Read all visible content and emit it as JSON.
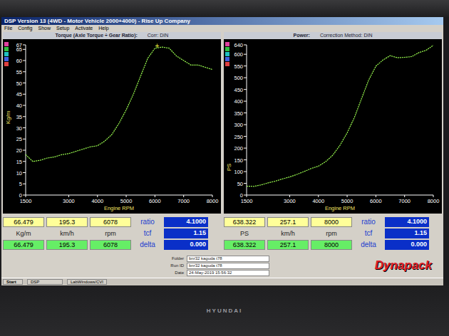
{
  "window": {
    "title": "DSP Version 13 (4WD - Motor Vehicle 2000+4000) - Rise Up Company"
  },
  "menu": [
    "File",
    "Config",
    "Show",
    "Setup",
    "Activate",
    "Help"
  ],
  "legend_swatches": [
    "#e040a0",
    "#30c040",
    "#20c0c0",
    "#4060e0",
    "#e04040"
  ],
  "charts": [
    {
      "title": "Torque (Axle Torque ÷ Gear Ratio):",
      "correction": "Corr: DIN",
      "y_label": "Kg/m",
      "x_label": "Engine RPM",
      "y_max": 67,
      "y_ticks": [
        "0",
        "5",
        "10",
        "15",
        "20",
        "25",
        "30",
        "35",
        "40",
        "45",
        "50",
        "55",
        "60",
        "65",
        "67"
      ],
      "x_ticks": [
        "1500",
        "3000",
        "4000",
        "5000",
        "6000",
        "7000",
        "8000"
      ],
      "rpm": [
        1500,
        1750,
        2000,
        2250,
        2500,
        2750,
        3000,
        3250,
        3500,
        3750,
        4000,
        4250,
        4500,
        4750,
        5000,
        5250,
        5500,
        5750,
        6000,
        6250,
        6500,
        6750,
        7000,
        7250,
        7500,
        7750,
        8000
      ],
      "values": [
        18,
        15,
        15.5,
        16.5,
        17,
        18,
        18.5,
        19.5,
        20.5,
        21.5,
        22,
        24,
        27,
        32,
        38,
        45,
        53,
        61,
        65.5,
        66,
        65.5,
        62,
        60,
        58,
        58,
        57,
        56
      ],
      "cursor": {
        "symbol": "+",
        "rpm": 6078,
        "value": 66.479
      }
    },
    {
      "title": "Power:",
      "correction": "Correction Method: DIN",
      "y_label": "PS",
      "x_label": "Engine RPM",
      "y_max": 640,
      "y_ticks": [
        "0",
        "50",
        "100",
        "150",
        "200",
        "250",
        "300",
        "350",
        "400",
        "450",
        "500",
        "550",
        "600",
        "640"
      ],
      "x_ticks": [
        "1500",
        "3000",
        "4000",
        "5000",
        "6000",
        "7000",
        "8000"
      ],
      "rpm": [
        1500,
        1750,
        2000,
        2250,
        2500,
        2750,
        3000,
        3250,
        3500,
        3750,
        4000,
        4250,
        4500,
        4750,
        5000,
        5250,
        5500,
        5750,
        6000,
        6250,
        6500,
        6750,
        7000,
        7250,
        7500,
        7750,
        8000
      ],
      "values": [
        38,
        37,
        43,
        52,
        59,
        69,
        77,
        88,
        100,
        113,
        123,
        142,
        170,
        212,
        265,
        330,
        410,
        490,
        549,
        576,
        594,
        585,
        587,
        590,
        607,
        617,
        638
      ]
    }
  ],
  "readouts": [
    {
      "rows": [
        {
          "kind": "cursor",
          "cells": [
            "66.479",
            "195.3",
            "6078"
          ],
          "label": "ratio",
          "value": "4.1000"
        },
        {
          "kind": "units",
          "cells": [
            "Kg/m",
            "km/h",
            "rpm"
          ],
          "label": "tcf",
          "value": "1.15"
        },
        {
          "kind": "delta",
          "cells": [
            "66.479",
            "195.3",
            "6078"
          ],
          "label": "delta",
          "value": "0.000"
        }
      ]
    },
    {
      "rows": [
        {
          "kind": "cursor",
          "cells": [
            "638.322",
            "257.1",
            "8000"
          ],
          "label": "ratio",
          "value": "4.1000"
        },
        {
          "kind": "units",
          "cells": [
            "PS",
            "km/h",
            "rpm"
          ],
          "label": "tcf",
          "value": "1.15"
        },
        {
          "kind": "delta",
          "cells": [
            "638.322",
            "257.1",
            "8000"
          ],
          "label": "delta",
          "value": "0.000"
        }
      ]
    }
  ],
  "info": [
    {
      "label": "Folder",
      "value": "bnr32 kaguda t78"
    },
    {
      "label": "Run ID",
      "value": "bnr32 kaguda t78"
    },
    {
      "label": "Date",
      "value": "24-May-2019 15:56:32"
    }
  ],
  "logo": "Dynapack",
  "taskbar": [
    "Start",
    "DSP",
    "LabWindows/CVI"
  ],
  "monitor": {
    "brand": "HYUNDAI"
  }
}
